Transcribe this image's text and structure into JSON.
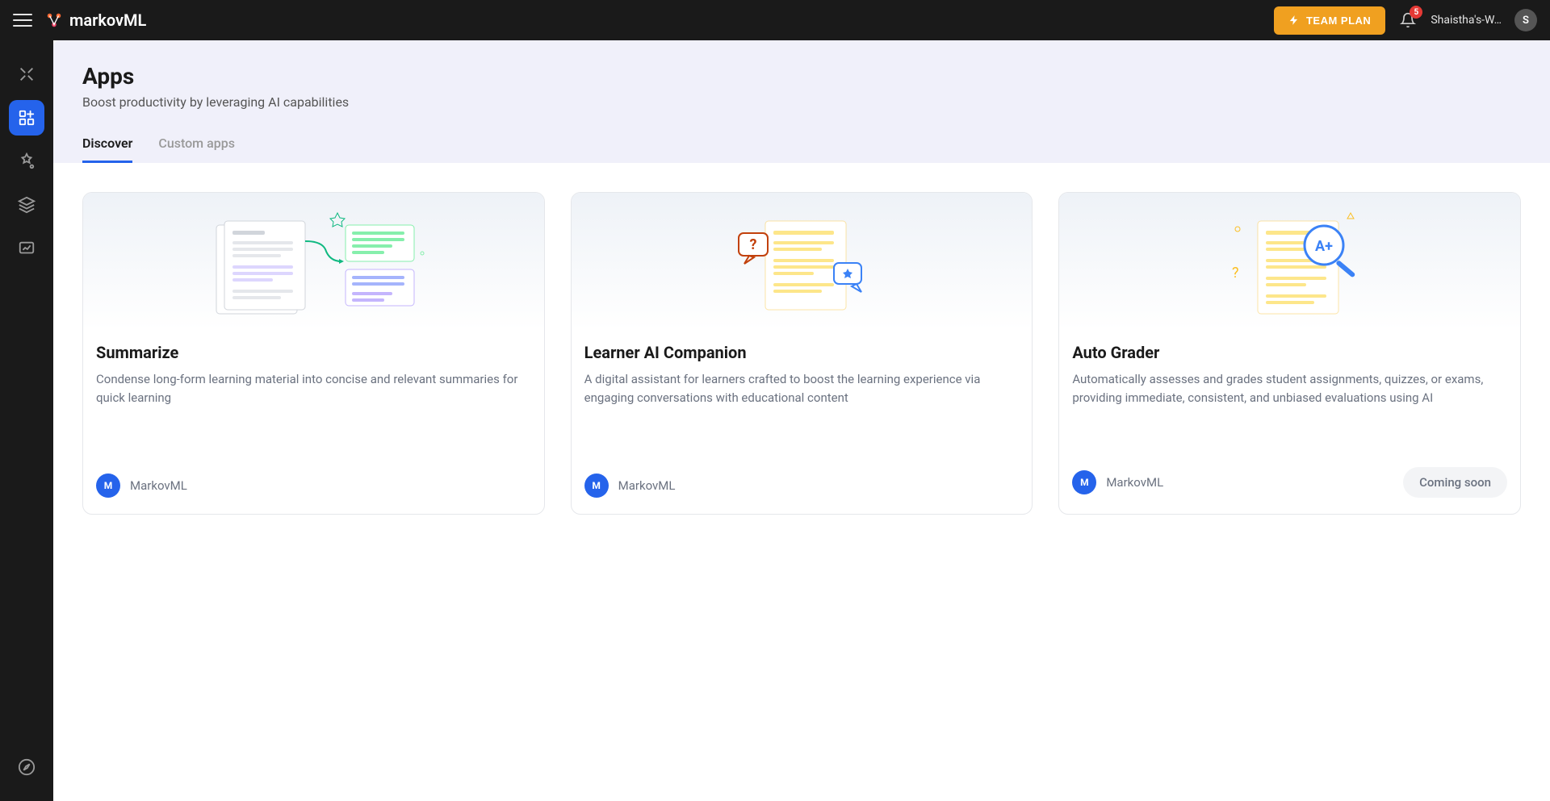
{
  "header": {
    "brand": "markovML",
    "team_plan_label": "TEAM PLAN",
    "notification_count": "5",
    "workspace_label": "Shaistha's-W…",
    "avatar_initial": "S"
  },
  "page": {
    "title": "Apps",
    "subtitle": "Boost productivity by leveraging AI capabilities"
  },
  "tabs": [
    {
      "label": "Discover",
      "active": true
    },
    {
      "label": "Custom apps",
      "active": false
    }
  ],
  "cards": [
    {
      "title": "Summarize",
      "description": "Condense long-form learning material into concise and relevant summaries for quick learning",
      "author_initial": "M",
      "author_name": "MarkovML",
      "coming_soon": false
    },
    {
      "title": "Learner AI Companion",
      "description": "A digital assistant for learners crafted to boost the learning experience via engaging conversations with educational content",
      "author_initial": "M",
      "author_name": "MarkovML",
      "coming_soon": false
    },
    {
      "title": "Auto Grader",
      "description": "Automatically assesses and grades student assignments, quizzes, or exams, providing immediate, consistent, and unbiased evaluations using AI",
      "author_initial": "M",
      "author_name": "MarkovML",
      "coming_soon": true,
      "coming_soon_label": "Coming soon"
    }
  ]
}
